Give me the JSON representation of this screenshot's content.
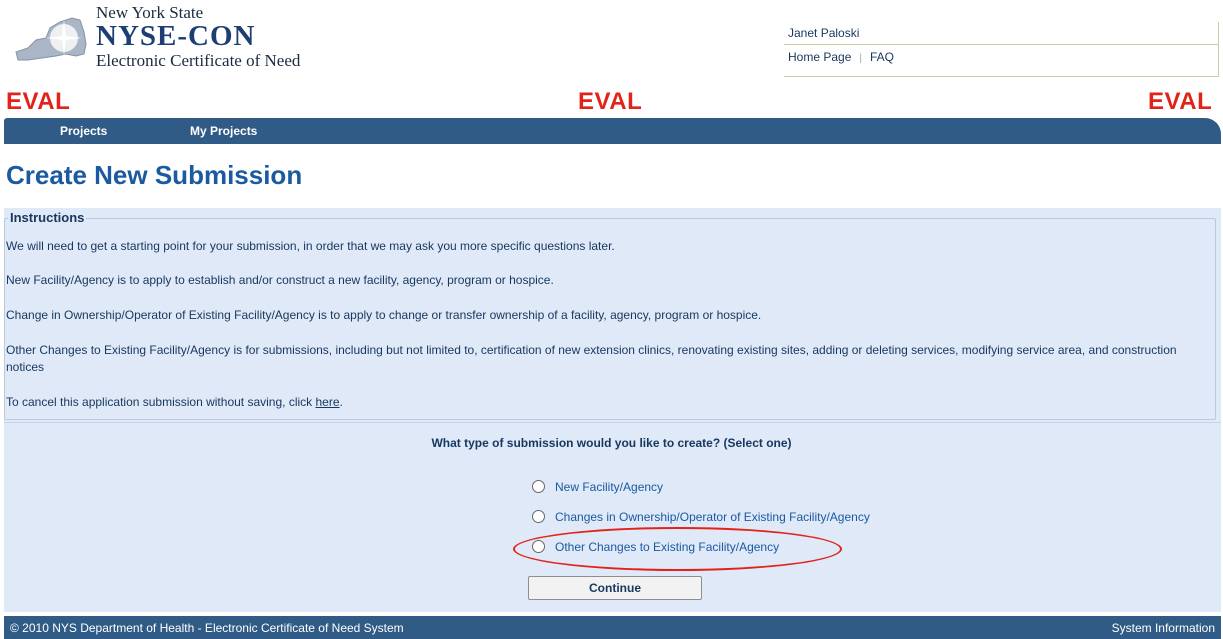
{
  "header": {
    "logo_line1": "New York State",
    "logo_line2": "NYSE-CON",
    "logo_line3": "Electronic Certificate of Need",
    "user_name": "Janet Paloski",
    "home_link": "Home Page",
    "sep": "|",
    "faq_link": "FAQ",
    "eval_text": "EVAL"
  },
  "nav": {
    "items": [
      {
        "label": "Projects"
      },
      {
        "label": "My Projects"
      }
    ]
  },
  "page_title": "Create New Submission",
  "instructions": {
    "legend": "Instructions",
    "p1": "We will need to get a starting point for your submission, in order that we may ask you more specific questions later.",
    "p2": "New Facility/Agency is to apply to establish and/or construct a new facility, agency, program or hospice.",
    "p3": "Change in Ownership/Operator of Existing Facility/Agency is to apply to change or transfer ownership of a facility, agency, program or hospice.",
    "p4": "Other Changes to Existing Facility/Agency is for submissions, including but not limited to, certification of new extension clinics, renovating existing sites, adding or deleting services, modifying service area, and construction notices",
    "p5_prefix": "To cancel this application submission without saving, click ",
    "p5_link": "here",
    "p5_suffix": "."
  },
  "question": "What type of submission would you like to create? (Select one)",
  "options": [
    {
      "label": "New Facility/Agency"
    },
    {
      "label": "Changes in Ownership/Operator of Existing Facility/Agency"
    },
    {
      "label": "Other Changes to Existing Facility/Agency"
    }
  ],
  "continue_label": "Continue",
  "footer": {
    "copyright": "© 2010 NYS Department of Health - Electronic Certificate of Need System",
    "system_info": "System Information"
  },
  "colors": {
    "nav_bg": "#2f5b86",
    "panel_bg": "#dfe9f8",
    "eval_red": "#e2231a",
    "title_blue": "#1b5aa0"
  }
}
